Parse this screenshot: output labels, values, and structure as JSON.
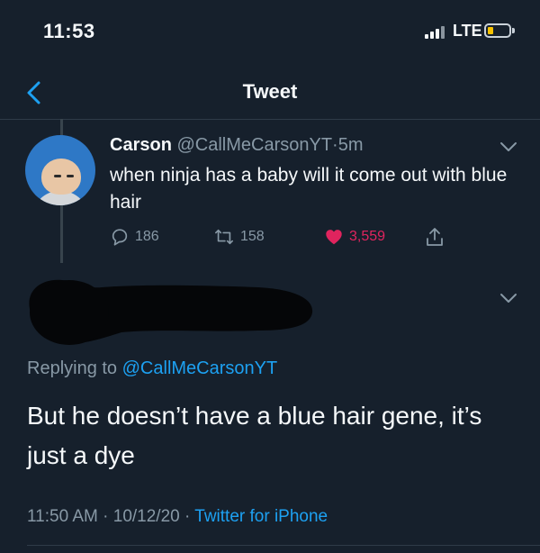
{
  "status_bar": {
    "time": "11:53",
    "network": "LTE",
    "signal_bars_active": 3,
    "signal_bars_total": 4,
    "battery_color": "#f7c200"
  },
  "nav": {
    "back_icon": "chevron-left-icon",
    "title": "Tweet",
    "accent": "#1da1f2"
  },
  "parent_tweet": {
    "name": "Carson",
    "handle": "@CallMeCarsonYT",
    "separator": "·",
    "age": "5m",
    "text": "when ninja has a baby will it come out with blue hair",
    "replies": "186",
    "retweets": "158",
    "likes": "3,559",
    "liked": true,
    "like_color": "#e0245e"
  },
  "reply_tweet": {
    "replying_label": "Replying to",
    "replying_handle": "@CallMeCarsonYT",
    "text": "But he doesn’t have a blue hair gene, it’s just a dye",
    "timestamp": "11:50 AM · 10/12/20 · ",
    "source": "Twitter for iPhone"
  }
}
